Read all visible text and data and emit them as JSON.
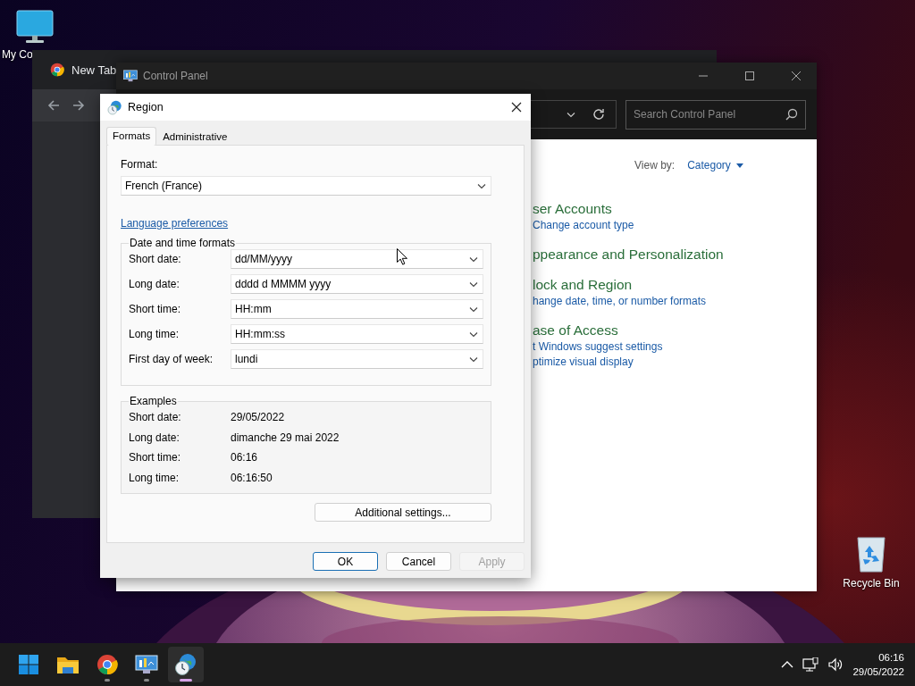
{
  "desktop_icons": [
    {
      "kind": "computer",
      "label": "My Co"
    },
    {
      "kind": "recycle_bin",
      "label": "Recycle Bin"
    }
  ],
  "browser_window": {
    "tab": "New Tab"
  },
  "control_panel": {
    "title": "Control Panel",
    "search": {
      "placeholder": "Search Control Panel"
    },
    "view_by_label": "View by:",
    "view_by_value": "Category",
    "categories": [
      {
        "title": "ser Accounts",
        "links": [
          "Change account type"
        ]
      },
      {
        "title": "ppearance and Personalization"
      },
      {
        "title": "lock and Region",
        "links": [
          "hange date, time, or number formats"
        ]
      },
      {
        "title": "ase of Access",
        "links": [
          "t Windows suggest settings",
          "ptimize visual display"
        ]
      }
    ]
  },
  "region_dialog": {
    "title": "Region",
    "tabs": [
      {
        "label": "Formats",
        "selected": true
      },
      {
        "label": "Administrative",
        "selected": false
      }
    ],
    "format_label": "Format:",
    "format_value": "French (France)",
    "language_link": "Language preferences",
    "formats_group": {
      "title": "Date and time formats",
      "rows": [
        {
          "label": "Short date:",
          "value": "dd/MM/yyyy"
        },
        {
          "label": "Long date:",
          "value": "dddd d MMMM yyyy"
        },
        {
          "label": "Short time:",
          "value": "HH:mm"
        },
        {
          "label": "Long time:",
          "value": "HH:mm:ss"
        },
        {
          "label": "First day of week:",
          "value": "lundi"
        }
      ]
    },
    "examples": {
      "title": "Examples",
      "rows": [
        {
          "label": "Short date:",
          "value": "29/05/2022"
        },
        {
          "label": "Long date:",
          "value": "dimanche 29 mai 2022"
        },
        {
          "label": "Short time:",
          "value": "06:16"
        },
        {
          "label": "Long time:",
          "value": "06:16:50"
        }
      ]
    },
    "additional_button": "Additional settings...",
    "buttons": [
      {
        "label": "OK",
        "default": true,
        "disabled": false
      },
      {
        "label": "Cancel",
        "default": false,
        "disabled": false
      },
      {
        "label": "Apply",
        "default": false,
        "disabled": true
      }
    ]
  },
  "taskbar": {
    "apps": [
      {
        "kind": "start",
        "running": false,
        "selected": false
      },
      {
        "kind": "explorer",
        "running": false,
        "selected": false
      },
      {
        "kind": "chrome",
        "running": true,
        "selected": false
      },
      {
        "kind": "control_panel",
        "running": true,
        "selected": false
      },
      {
        "kind": "region",
        "running": true,
        "selected": true
      }
    ],
    "time": "06:16",
    "date": "29/05/2022"
  }
}
